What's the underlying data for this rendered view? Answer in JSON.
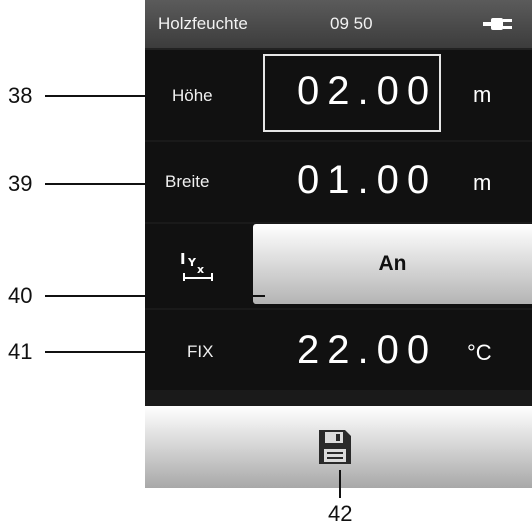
{
  "status_bar": {
    "title": "Holzfeuchte",
    "time": "09 50",
    "power_icon": "plug-icon"
  },
  "rows": {
    "hoehe": {
      "label": "Höhe",
      "value": "02.00",
      "unit": "m"
    },
    "breite": {
      "label": "Breite",
      "value": "01.00",
      "unit": "m"
    },
    "unit_toggle": {
      "icon": "dimension-unit-icon",
      "button_label": "An"
    },
    "fix": {
      "label": "FIX",
      "value": "22.00",
      "unit": "°C"
    },
    "save": {
      "icon": "floppy-disk-icon"
    }
  },
  "callouts": {
    "c38": "38",
    "c39": "39",
    "c40": "40",
    "c41": "41",
    "c42": "42"
  },
  "colors": {
    "screen_background": "#1a1a1a",
    "status_bar": "#4a4a4a",
    "button_gradient_top": "#ffffff",
    "button_gradient_bottom": "#b4b4b4"
  }
}
